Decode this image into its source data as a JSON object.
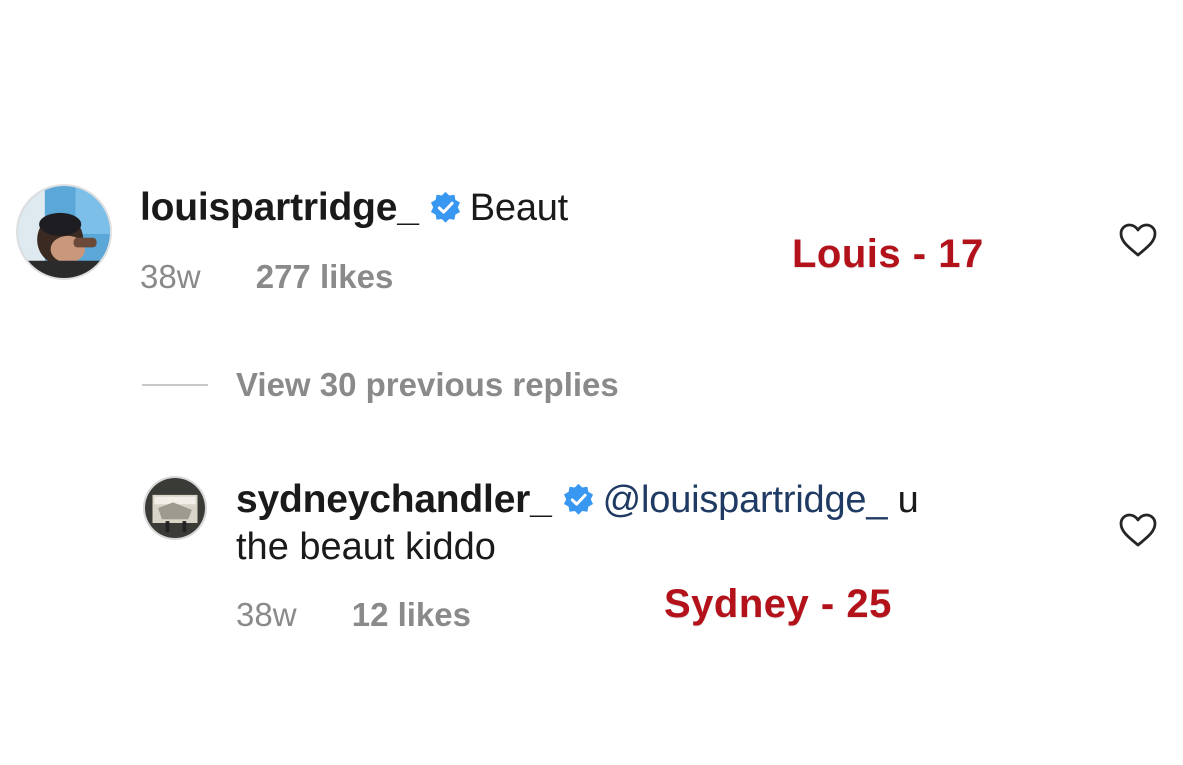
{
  "comment": {
    "username": "louispartridge_",
    "text": "Beaut",
    "age": "38w",
    "likes": "277 likes",
    "annotation": "Louis - 17"
  },
  "replies_toggle": {
    "label": "View 30 previous replies"
  },
  "reply": {
    "username": "sydneychandler_",
    "mention": "@louispartridge_",
    "text_line1_suffix": " u",
    "text_line2": "the beaut kiddo",
    "age": "38w",
    "likes": "12 likes",
    "annotation": "Sydney - 25"
  },
  "colors": {
    "verified_badge": "#3897f0",
    "annotation": "#b3121b",
    "mention": "#1f3a63",
    "meta": "#8a8a8a"
  },
  "icons": {
    "verified": "verified-badge-icon",
    "like": "heart-outline-icon"
  }
}
